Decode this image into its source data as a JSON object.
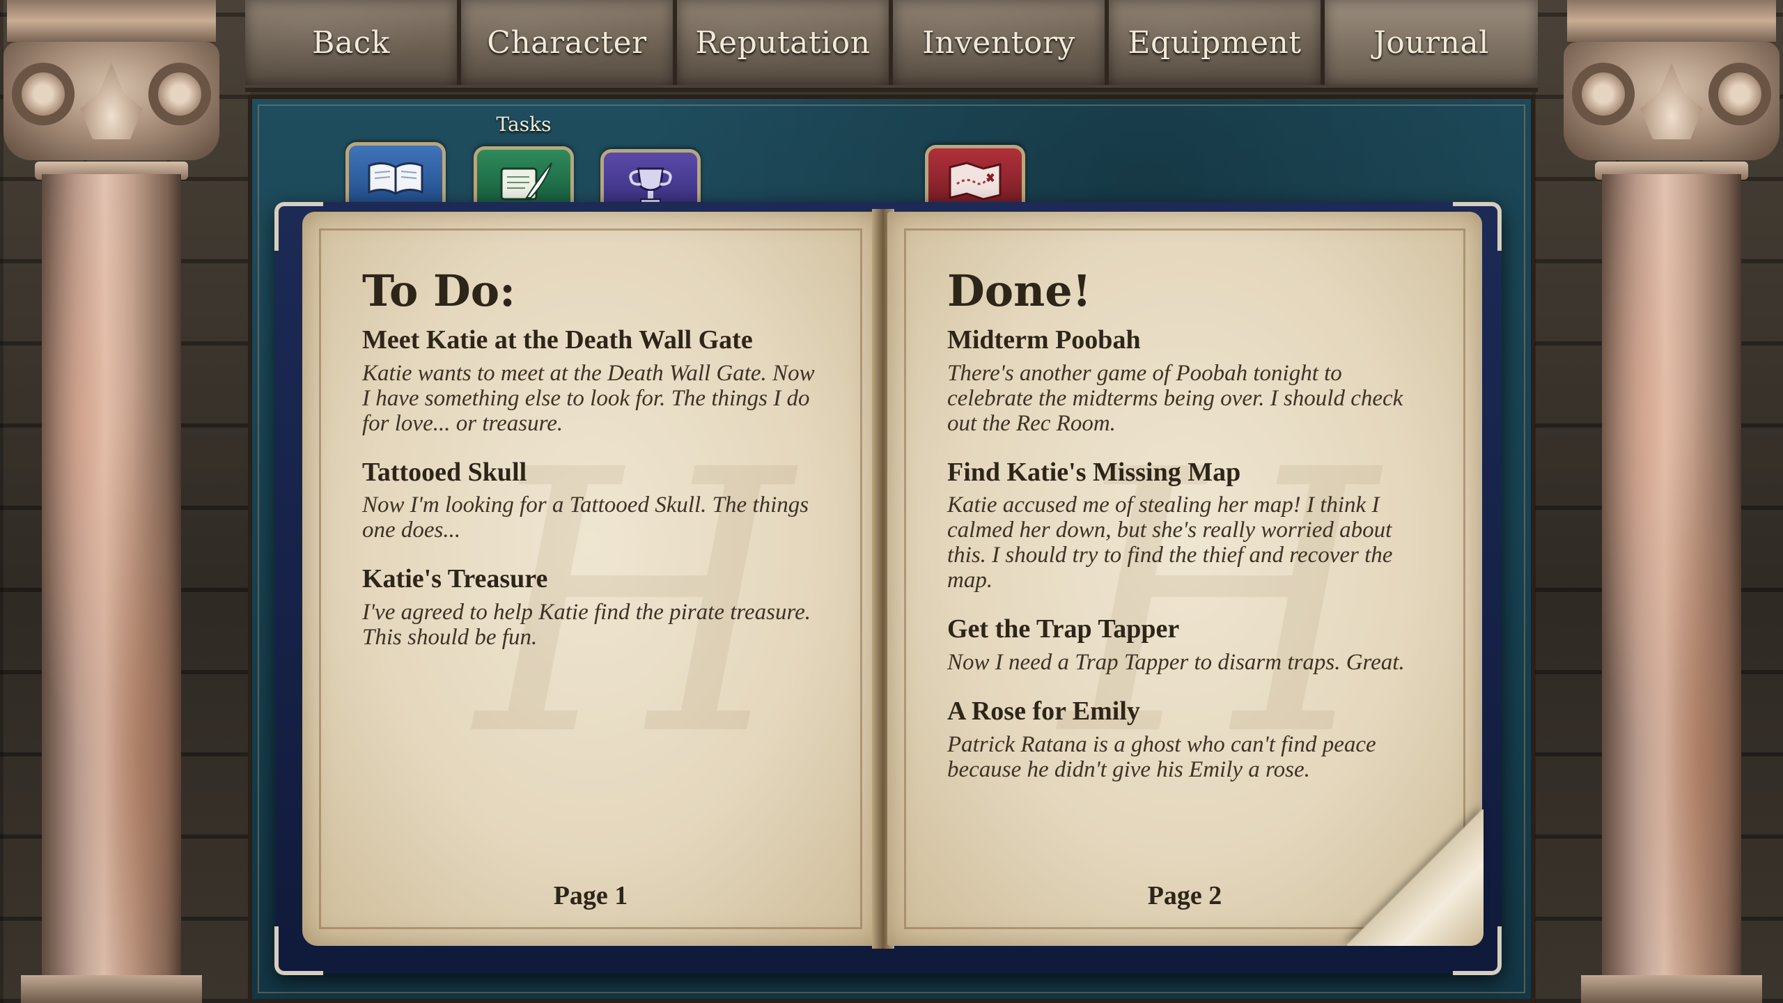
{
  "nav": {
    "tabs": [
      {
        "label": "Back"
      },
      {
        "label": "Character"
      },
      {
        "label": "Reputation"
      },
      {
        "label": "Inventory"
      },
      {
        "label": "Equipment"
      },
      {
        "label": "Journal"
      }
    ],
    "active_tab": "Journal"
  },
  "journal_tabs": {
    "hover_label": "Tasks",
    "icons": [
      "book-icon",
      "quill-scroll-icon",
      "trophy-icon",
      "treasure-map-icon"
    ]
  },
  "book": {
    "left_page": {
      "heading": "To Do:",
      "entries": [
        {
          "title": "Meet Katie at the Death Wall Gate",
          "text": "Katie wants to meet at the Death Wall Gate. Now I have something else to look for. The things I do for love... or treasure."
        },
        {
          "title": "Tattooed Skull",
          "text": "Now I'm looking for a Tattooed Skull. The things one does..."
        },
        {
          "title": "Katie's Treasure",
          "text": "I've agreed to help Katie find the pirate treasure. This should be fun."
        }
      ],
      "page_label": "Page 1"
    },
    "right_page": {
      "heading": "Done!",
      "entries": [
        {
          "title": "Midterm Poobah",
          "text": "There's another game of Poobah tonight to celebrate the midterms being over. I should check out the Rec Room."
        },
        {
          "title": "Find Katie's Missing Map",
          "text": "Katie accused me of stealing her map! I think I calmed her down, but she's really worried about this. I should try to find the thief and recover the map."
        },
        {
          "title": "Get the Trap Tapper",
          "text": "Now I need a Trap Tapper to disarm traps. Great."
        },
        {
          "title": "A Rose for Emily",
          "text": "Patrick Ratana is a ghost who can't find peace because he didn't give his Emily a rose."
        }
      ],
      "page_label": "Page 2"
    }
  },
  "colors": {
    "board": "#1a4556",
    "parchment": "#e8dcc2",
    "ink": "#2e2519",
    "tab_text": "#f3e9d8"
  }
}
